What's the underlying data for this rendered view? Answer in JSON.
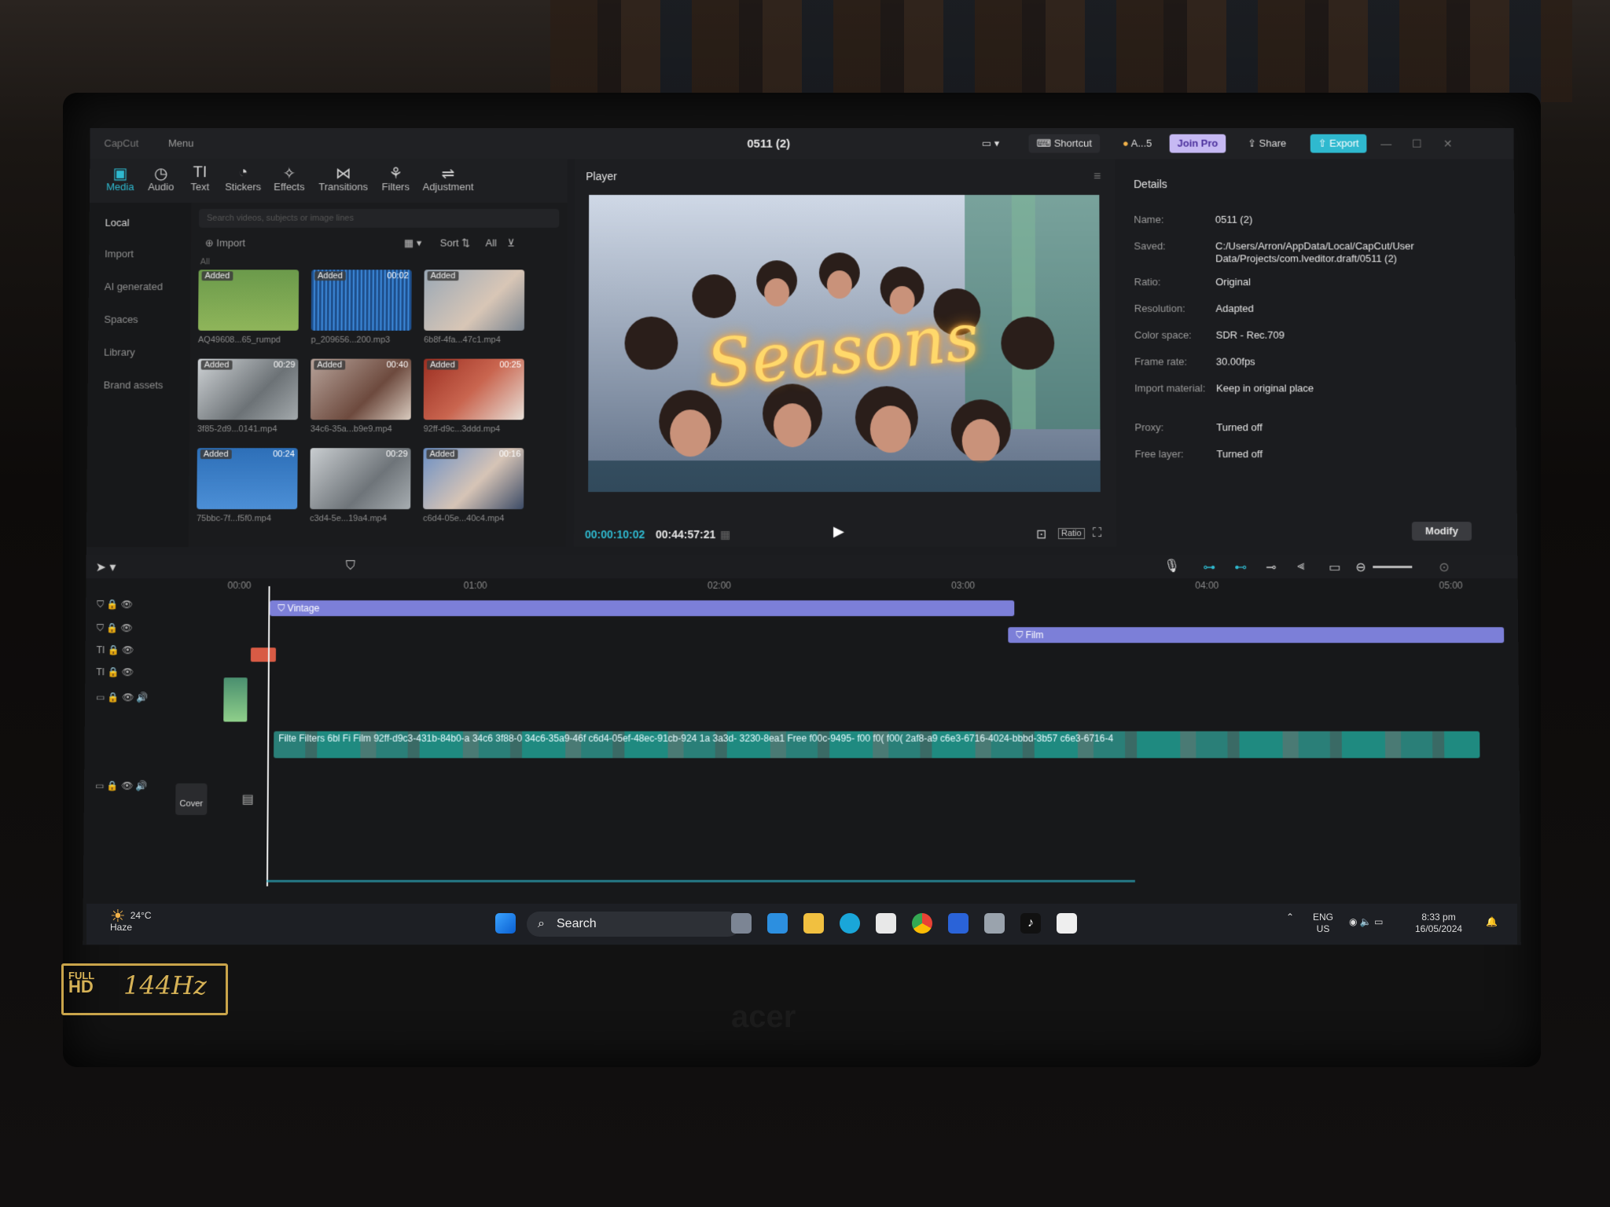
{
  "titlebar": {
    "app_logo": "CapCut",
    "menu": "Menu",
    "project_title": "0511 (2)",
    "shortcut": "Shortcut",
    "account": "A...5",
    "join_pro": "Join Pro",
    "share": "Share",
    "export": "Export"
  },
  "toolbar": {
    "items": [
      "Media",
      "Audio",
      "Text",
      "Stickers",
      "Effects",
      "Transitions",
      "Filters",
      "Adjustment"
    ],
    "active": "Media"
  },
  "sidenav": {
    "items": [
      "Local",
      "Import",
      "AI generated",
      "Spaces",
      "Library",
      "Brand assets"
    ]
  },
  "media": {
    "search_placeholder": "Search videos, subjects or image lines",
    "import": "Import",
    "sort": "Sort",
    "filter_all": "All",
    "section": "All",
    "tiles": [
      {
        "badge": "Added",
        "duration": "",
        "name": "AQ49608...65_rumpd"
      },
      {
        "badge": "Added",
        "duration": "00:02",
        "name": "p_209656...200.mp3"
      },
      {
        "badge": "Added",
        "duration": "",
        "name": "6b8f-4fa...47c1.mp4"
      },
      {
        "badge": "Added",
        "duration": "00:29",
        "name": "3f85-2d9...0141.mp4"
      },
      {
        "badge": "Added",
        "duration": "00:40",
        "name": "34c6-35a...b9e9.mp4"
      },
      {
        "badge": "Added",
        "duration": "00:25",
        "name": "92ff-d9c...3ddd.mp4"
      },
      {
        "badge": "Added",
        "duration": "00:24",
        "name": "75bbc-7f...f5f0.mp4"
      },
      {
        "badge": "",
        "duration": "00:29",
        "name": "c3d4-5e...19a4.mp4"
      },
      {
        "badge": "Added",
        "duration": "00:16",
        "name": "c6d4-05e...40c4.mp4"
      }
    ]
  },
  "player": {
    "title": "Player",
    "overlay_text": "Seasons",
    "current_time": "00:00:10:02",
    "total_time": "00:44:57:21",
    "ratio_btn": "Ratio"
  },
  "details": {
    "title": "Details",
    "rows": [
      {
        "label": "Name:",
        "value": "0511 (2)"
      },
      {
        "label": "Saved:",
        "value": "C:/Users/Arron/AppData/Local/CapCut/User Data/Projects/com.lveditor.draft/0511 (2)"
      },
      {
        "label": "Ratio:",
        "value": "Original"
      },
      {
        "label": "Resolution:",
        "value": "Adapted"
      },
      {
        "label": "Color space:",
        "value": "SDR - Rec.709"
      },
      {
        "label": "Frame rate:",
        "value": "30.00fps"
      },
      {
        "label": "Import material:",
        "value": "Keep in original place"
      },
      {
        "label": "Proxy:",
        "value": "Turned off"
      },
      {
        "label": "Free layer:",
        "value": "Turned off"
      }
    ],
    "modify": "Modify"
  },
  "timeline": {
    "ruler": [
      "00:00",
      "01:00",
      "02:00",
      "03:00",
      "04:00",
      "05:00"
    ],
    "clips": {
      "vintage": "Vintage",
      "film": "Film",
      "main_strip": "Filte  Filters  6bl  Fi  Film  92ff-d9c3-431b-84b0-a  34c6  3f88-0  34c6-35a9-46f  c6d4-05ef-48ec-91cb-924  1a  3a3d-  3230-8ea1  Free  f00c-9495-  f00  f0(  f00(  2af8-a9  c6e3-6716-4024-bbbd-3b57  c6e3-6716-4"
    },
    "cover": "Cover"
  },
  "taskbar": {
    "temperature": "24°C",
    "weather": "Haze",
    "search": "Search",
    "lang": "ENG",
    "region": "US",
    "time": "8:33 pm",
    "date": "16/05/2024"
  },
  "bezel": {
    "hd_full": "FULL",
    "hd_hd": "HD",
    "hd_refresh": "144Hz",
    "brand": "acer"
  },
  "colors": {
    "accent": "#2fb9cf",
    "clip_bar": "#7c7fd8",
    "strip": "#2a7f78"
  }
}
